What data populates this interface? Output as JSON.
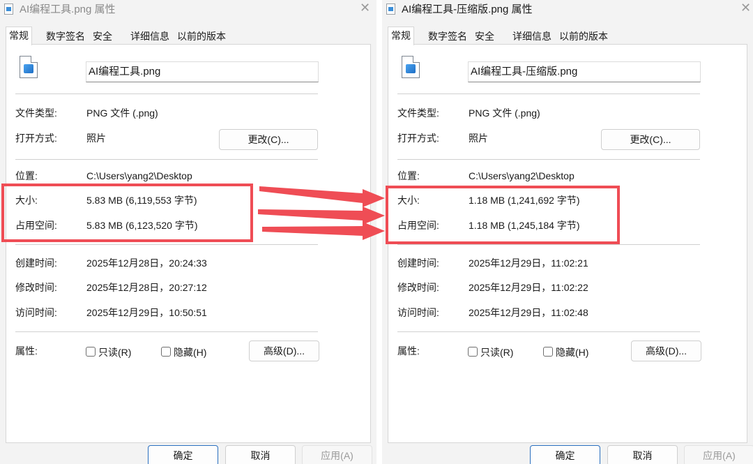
{
  "accent": "#ef4d55",
  "dialogs": [
    {
      "title": "AI编程工具.png 属性",
      "tabs": [
        "常规",
        "数字签名",
        "安全",
        "详细信息",
        "以前的版本"
      ],
      "active_tab": "常规",
      "file_name": "AI编程工具.png",
      "file_type_label": "文件类型:",
      "file_type": "PNG 文件 (.png)",
      "opens_with_label": "打开方式:",
      "opens_with": "照片",
      "change_button": "更改(C)...",
      "location_label": "位置:",
      "location": "C:\\Users\\yang2\\Desktop",
      "size_label": "大小:",
      "size": "5.83 MB (6,119,553 字节)",
      "size_on_disk_label": "占用空间:",
      "size_on_disk": "5.83 MB (6,123,520 字节)",
      "created_label": "创建时间:",
      "created": "2025年12月28日，20:24:33",
      "modified_label": "修改时间:",
      "modified": "2025年12月28日，20:27:12",
      "accessed_label": "访问时间:",
      "accessed": "2025年12月29日，10:50:51",
      "attributes_label": "属性:",
      "readonly_label": "只读(R)",
      "hidden_label": "隐藏(H)",
      "advanced_button": "高级(D)...",
      "ok_button": "确定",
      "cancel_button": "取消",
      "apply_button": "应用(A)"
    },
    {
      "title": "AI编程工具-压缩版.png 属性",
      "tabs": [
        "常规",
        "数字签名",
        "安全",
        "详细信息",
        "以前的版本"
      ],
      "active_tab": "常规",
      "file_name": "AI编程工具-压缩版.png",
      "file_type_label": "文件类型:",
      "file_type": "PNG 文件 (.png)",
      "opens_with_label": "打开方式:",
      "opens_with": "照片",
      "change_button": "更改(C)...",
      "location_label": "位置:",
      "location": "C:\\Users\\yang2\\Desktop",
      "size_label": "大小:",
      "size": "1.18 MB (1,241,692 字节)",
      "size_on_disk_label": "占用空间:",
      "size_on_disk": "1.18 MB (1,245,184 字节)",
      "created_label": "创建时间:",
      "created": "2025年12月29日，11:02:21",
      "modified_label": "修改时间:",
      "modified": "2025年12月29日，11:02:22",
      "accessed_label": "访问时间:",
      "accessed": "2025年12月29日，11:02:48",
      "attributes_label": "属性:",
      "readonly_label": "只读(R)",
      "hidden_label": "隐藏(H)",
      "advanced_button": "高级(D)...",
      "ok_button": "确定",
      "cancel_button": "取消",
      "apply_button": "应用(A)"
    }
  ]
}
